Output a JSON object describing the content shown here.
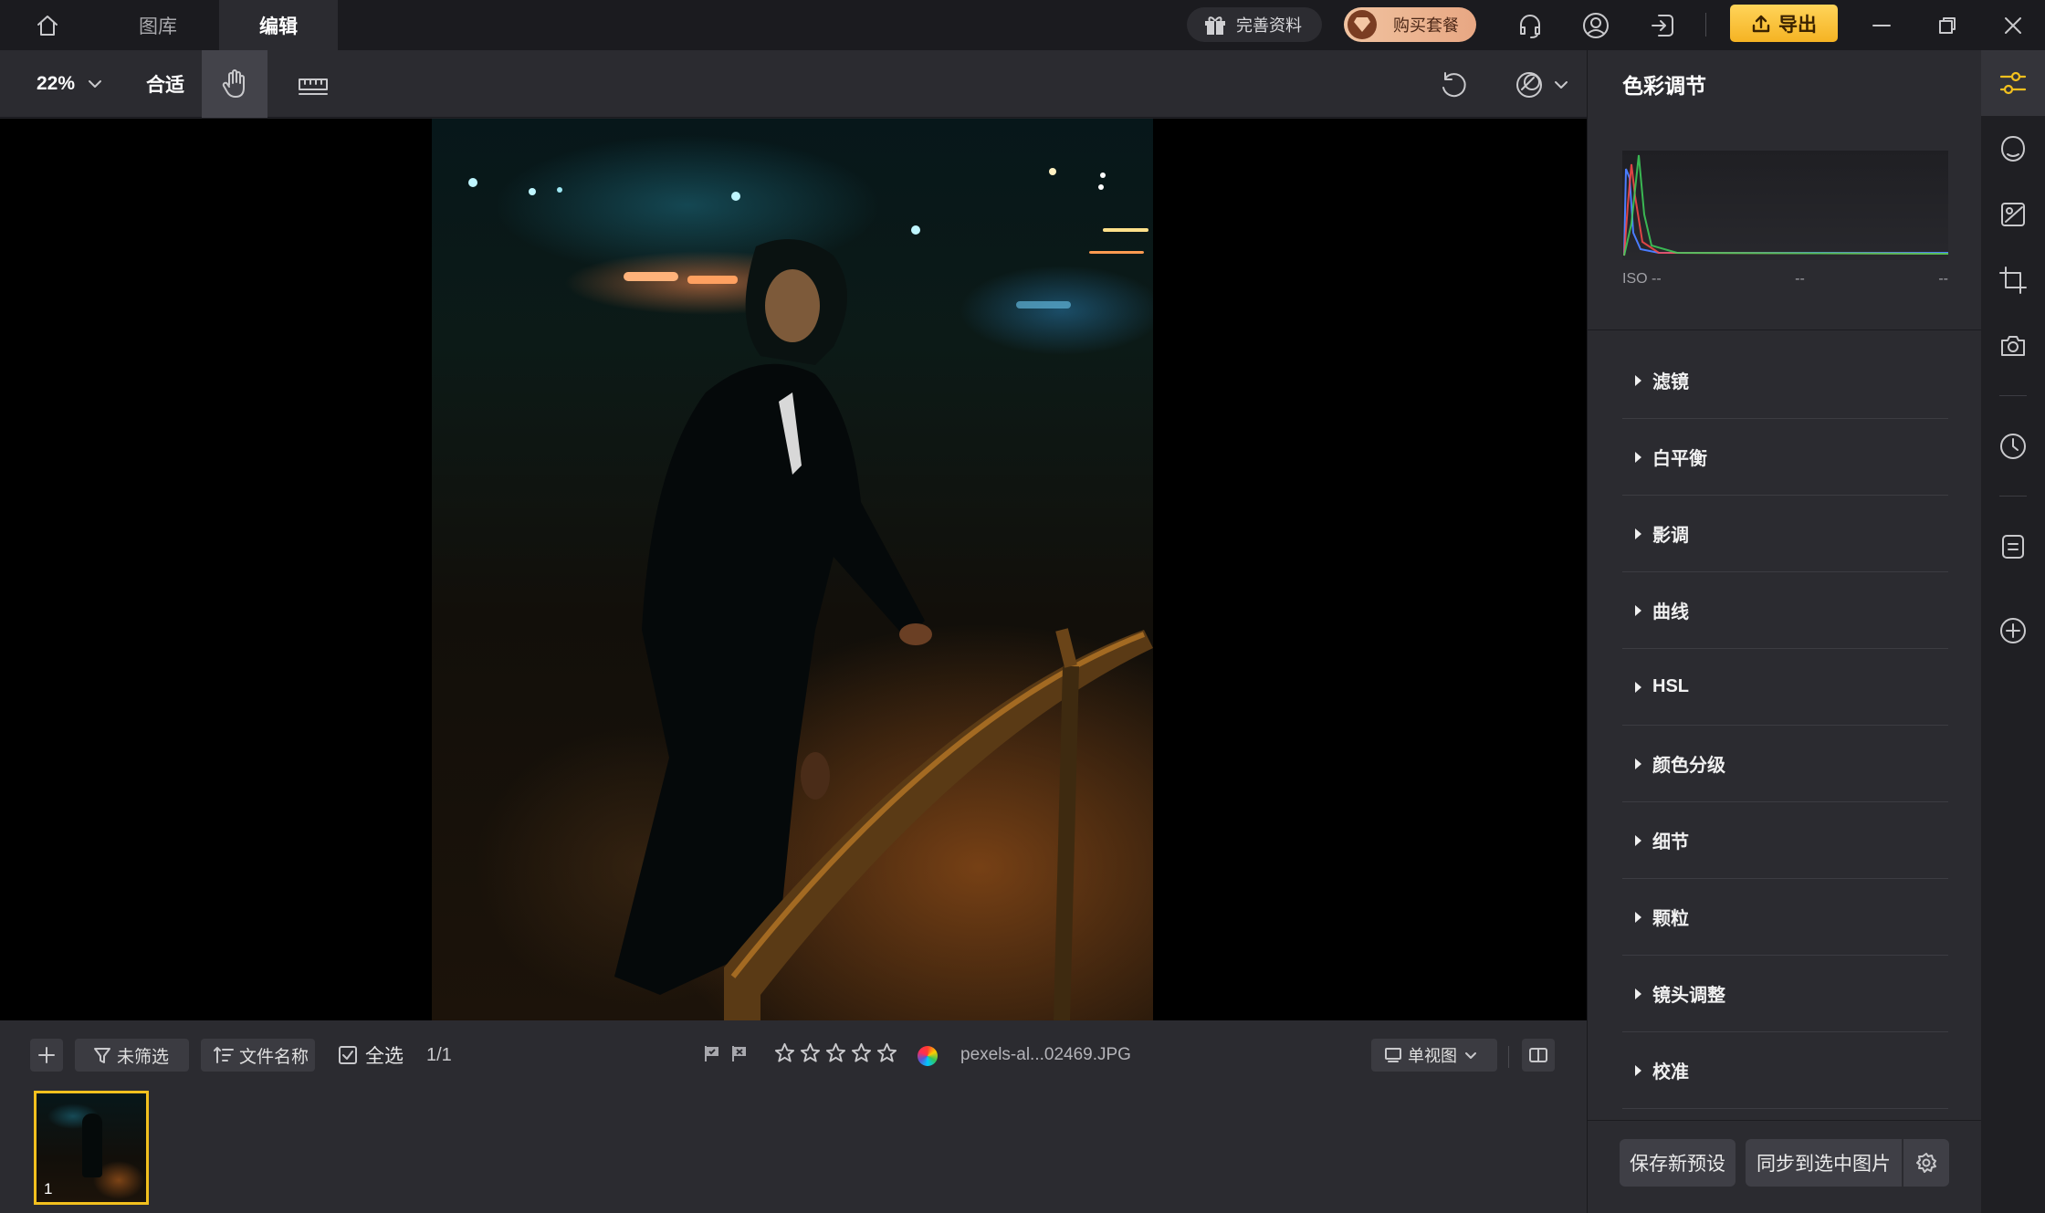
{
  "titlebar": {
    "tabs": [
      "图库",
      "编辑"
    ],
    "active_tab": 1,
    "profile_label": "完善资料",
    "buy_label": "购买套餐",
    "export_label": "导出"
  },
  "toolbar": {
    "zoom_level": "22%",
    "fit_label": "合适"
  },
  "filmstrip": {
    "filter_label": "未筛选",
    "sort_label": "文件名称",
    "select_all_label": "全选",
    "count": "1/1",
    "filename": "pexels-al...02469.JPG",
    "view_mode_label": "单视图",
    "thumb_number": "1",
    "rating": 0
  },
  "panel": {
    "title": "色彩调节",
    "exif": {
      "iso": "ISO --",
      "field2": "--",
      "field3": "--"
    },
    "sections": [
      "滤镜",
      "白平衡",
      "影调",
      "曲线",
      "HSL",
      "颜色分级",
      "细节",
      "颗粒",
      "镜头调整",
      "校准"
    ],
    "save_preset_label": "保存新预设",
    "sync_label": "同步到选中图片"
  },
  "rail": {
    "icons": [
      "sliders-icon",
      "mask-icon",
      "image-edit-icon",
      "crop-icon",
      "camera-icon",
      "history-icon",
      "notes-icon",
      "add-icon"
    ]
  },
  "colors": {
    "accent": "#f5b323",
    "background": "#2b2b30",
    "titlebar": "#1b1b1f",
    "selection": "#f2c01e"
  }
}
